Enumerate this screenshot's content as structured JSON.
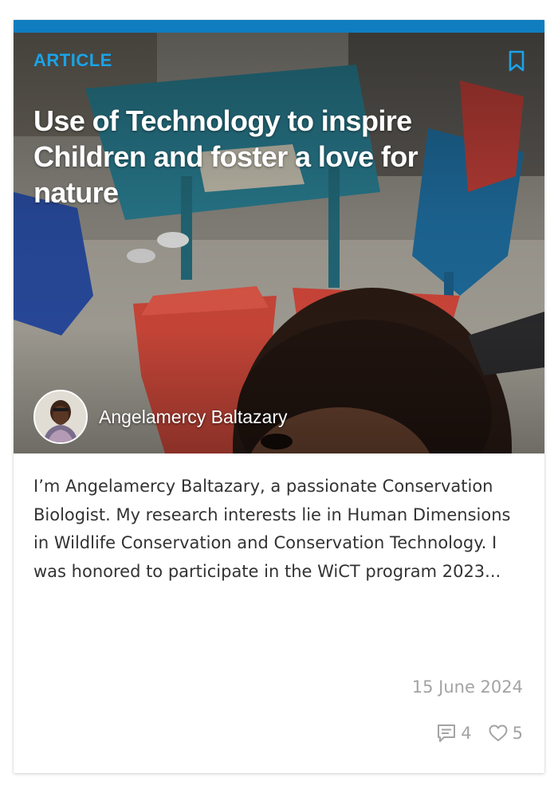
{
  "card": {
    "type_label": "ARTICLE",
    "title": "Use of Technology to inspire Children and foster a love for nature",
    "author": {
      "name": "Angelamercy Baltazary"
    },
    "excerpt": "I’m Angelamercy Baltazary, a passionate Conservation Biologist. My research interests lie in Human Dimensions in Wildlife Conservation and Conservation Technology. I was honored to participate in the WiCT program 2023...",
    "date": "15 June 2024",
    "comments_count": "4",
    "likes_count": "5"
  },
  "icons": {
    "bookmark": "bookmark-icon",
    "comments": "comment-icon",
    "likes": "heart-icon"
  },
  "colors": {
    "accent_bar": "#0f7dbf",
    "type_label": "#1aa3e8",
    "muted_text": "#a3a3a3",
    "body_text": "#333333"
  }
}
